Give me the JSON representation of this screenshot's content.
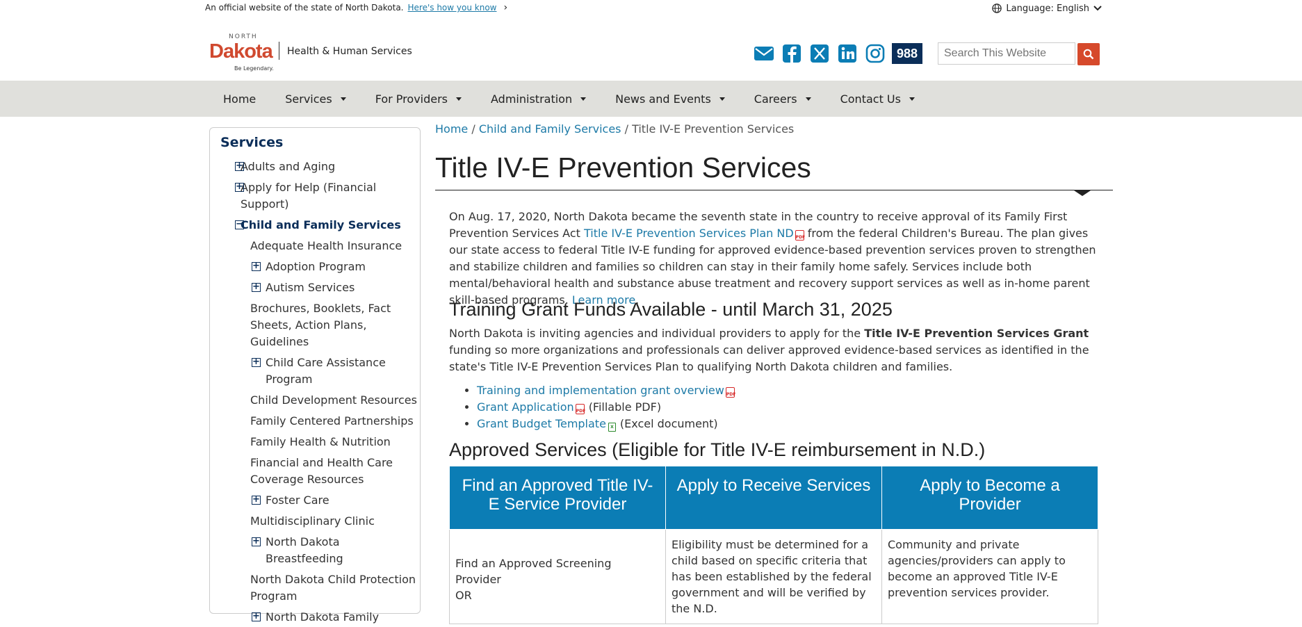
{
  "official_bar": {
    "text": "An official website of the state of North Dakota.",
    "link": "Here's how you know",
    "language_label": "Language: English"
  },
  "header": {
    "logo_north": "NORTH",
    "logo_dakota": "Dakota",
    "logo_tagline": "Be Legendary.",
    "agency_name": "Health & Human Services",
    "social_icons": [
      "email-icon",
      "facebook-icon",
      "x-icon",
      "linkedin-icon",
      "instagram-icon"
    ],
    "badge_988": "988",
    "search_placeholder": "Search This Website"
  },
  "nav": {
    "items": [
      {
        "label": "Home",
        "dropdown": false
      },
      {
        "label": "Services",
        "dropdown": true
      },
      {
        "label": "For Providers",
        "dropdown": true
      },
      {
        "label": "Administration",
        "dropdown": true
      },
      {
        "label": "News and Events",
        "dropdown": true
      },
      {
        "label": "Careers",
        "dropdown": true
      },
      {
        "label": "Contact Us",
        "dropdown": true
      }
    ]
  },
  "sidebar": {
    "title": "Services",
    "items": [
      {
        "label": "Adults and Aging",
        "level": 0,
        "toggle": "+"
      },
      {
        "label": "Apply for Help (Financial Support)",
        "level": 0,
        "toggle": "+"
      },
      {
        "label": "Child and Family Services",
        "level": 0,
        "toggle": "−",
        "active": true
      },
      {
        "label": "Adequate Health Insurance",
        "level": 1,
        "toggle": ""
      },
      {
        "label": "Adoption Program",
        "level": 1,
        "toggle": "+"
      },
      {
        "label": "Autism Services",
        "level": 1,
        "toggle": "+"
      },
      {
        "label": "Brochures, Booklets, Fact Sheets, Action Plans, Guidelines",
        "level": 1,
        "toggle": ""
      },
      {
        "label": "Child Care Assistance Program",
        "level": 1,
        "toggle": "+"
      },
      {
        "label": "Child Development Resources",
        "level": 1,
        "toggle": ""
      },
      {
        "label": "Family Centered Partnerships",
        "level": 1,
        "toggle": ""
      },
      {
        "label": "Family Health & Nutrition",
        "level": 1,
        "toggle": ""
      },
      {
        "label": "Financial and Health Care Coverage Resources",
        "level": 1,
        "toggle": ""
      },
      {
        "label": "Foster Care",
        "level": 1,
        "toggle": "+"
      },
      {
        "label": "Multidisciplinary Clinic",
        "level": 1,
        "toggle": ""
      },
      {
        "label": "North Dakota Breastfeeding",
        "level": 1,
        "toggle": "+"
      },
      {
        "label": "North Dakota Child Protection Program",
        "level": 1,
        "toggle": ""
      },
      {
        "label": "North Dakota Family",
        "level": 1,
        "toggle": "+"
      }
    ]
  },
  "breadcrumb": {
    "home": "Home",
    "sep": "/",
    "parent": "Child and Family Services",
    "current": "Title IV-E Prevention Services"
  },
  "page_title": "Title IV-E Prevention Services",
  "intro": {
    "part1": "On Aug. 17, 2020, North Dakota became the seventh state in the country to receive approval of its Family First Prevention Services Act ",
    "link1": "Title IV-E Prevention Services Plan ND",
    "part2": " from the federal Children's Bureau. The plan gives our state access to federal Title IV-E funding for approved evidence-based prevention services proven to strengthen and stabilize children and families so children can stay in their family home safely. Services include both mental/behavioral health and substance abuse treatment and recovery support services as well as in-home parent skill-based programs. ",
    "link2": "Learn more",
    "part3": "."
  },
  "grant": {
    "heading": "Training Grant Funds Available - until March 31, 2025",
    "text1": "North Dakota is inviting agencies and individual providers to apply for the ",
    "bold": "Title IV-E Prevention Services Grant",
    "text2": " funding so more organizations and professionals can deliver approved evidence-based services as identified in the state's Title IV-E Prevention Services Plan to qualifying North Dakota children and families.",
    "links": [
      {
        "label": "Training and implementation grant overview",
        "file": "pdf",
        "note": ""
      },
      {
        "label": "Grant Application",
        "file": "pdf",
        "note": "(Fillable PDF)"
      },
      {
        "label": "Grant Budget Template",
        "file": "xls",
        "note": "(Excel document)"
      }
    ]
  },
  "approved": {
    "heading": "Approved Services (Eligible for Title IV-E reimbursement in N.D.)",
    "columns": [
      "Find an Approved Title IV-E Service Provider",
      "Apply to Receive Services",
      "Apply to Become a Provider"
    ],
    "cells": [
      "Find an Approved Screening Provider",
      "Eligibility must be determined for a child based on specific criteria that has been established by the federal government and will be verified by the N.D.",
      "Community and private agencies/providers can apply to become an approved Title IV-E prevention services provider."
    ],
    "cell1_extra": "OR"
  }
}
